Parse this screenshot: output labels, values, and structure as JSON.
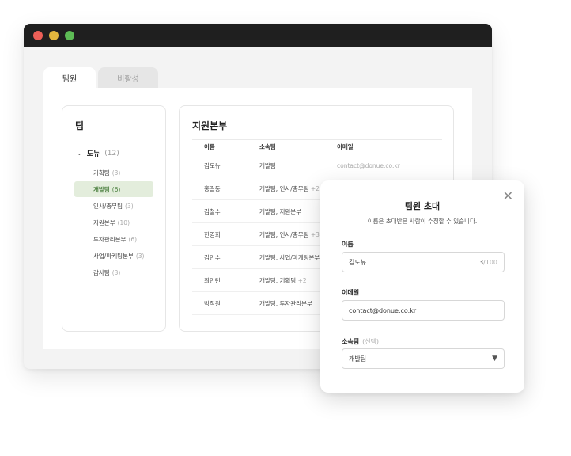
{
  "tabs": {
    "members": "팀원",
    "inactive": "비활성"
  },
  "team_panel": {
    "title": "팀",
    "org": {
      "name": "도뉴",
      "count": "(12)"
    },
    "teams": [
      {
        "name": "기획팀",
        "count": "(3)"
      },
      {
        "name": "개발팀",
        "count": "(6)"
      },
      {
        "name": "인사/총무팀",
        "count": "(3)"
      },
      {
        "name": "지원본부",
        "count": "(10)"
      },
      {
        "name": "투자관리본부",
        "count": "(6)"
      },
      {
        "name": "사업/마케팅본부",
        "count": "(3)"
      },
      {
        "name": "감사팀",
        "count": "(3)"
      }
    ]
  },
  "member_panel": {
    "title": "지원본부",
    "headers": {
      "name": "이름",
      "team": "소속팀",
      "email": "이메일"
    },
    "rows": [
      {
        "name": "김도뉴",
        "team": "개발팀",
        "extra": "",
        "email": "contact@donue.co.kr"
      },
      {
        "name": "홍길동",
        "team": "개발팀, 인사/총무팀",
        "extra": "+2",
        "email": ""
      },
      {
        "name": "김철수",
        "team": "개발팀, 지원본부",
        "extra": "",
        "email": ""
      },
      {
        "name": "한영희",
        "team": "개발팀, 인사/총무팀",
        "extra": "+3",
        "email": ""
      },
      {
        "name": "김민수",
        "team": "개발팀, 사업/마케팅본부",
        "extra": "",
        "email": ""
      },
      {
        "name": "최민턴",
        "team": "개발팀, 기획팀",
        "extra": "+2",
        "email": ""
      },
      {
        "name": "박직원",
        "team": "개발팀, 투자관리본부",
        "extra": "",
        "email": ""
      }
    ]
  },
  "modal": {
    "title": "팀원 초대",
    "subtitle": "이름은 초대받은 사람이 수정할 수 있습니다.",
    "name_label": "이름",
    "name_value": "김도뉴",
    "name_count": "3",
    "name_max": "/100",
    "email_label": "이메일",
    "email_value": "contact@donue.co.kr",
    "team_label": "소속팀",
    "team_optional": "(선택)",
    "team_value": "개발팀",
    "close_icon": "close-icon",
    "select_icon": "caret-down-icon"
  },
  "colors": {
    "titlebar": "#1f1f1f",
    "selected_bg": "#e3eddc",
    "selected_text": "#4a7f3e"
  }
}
